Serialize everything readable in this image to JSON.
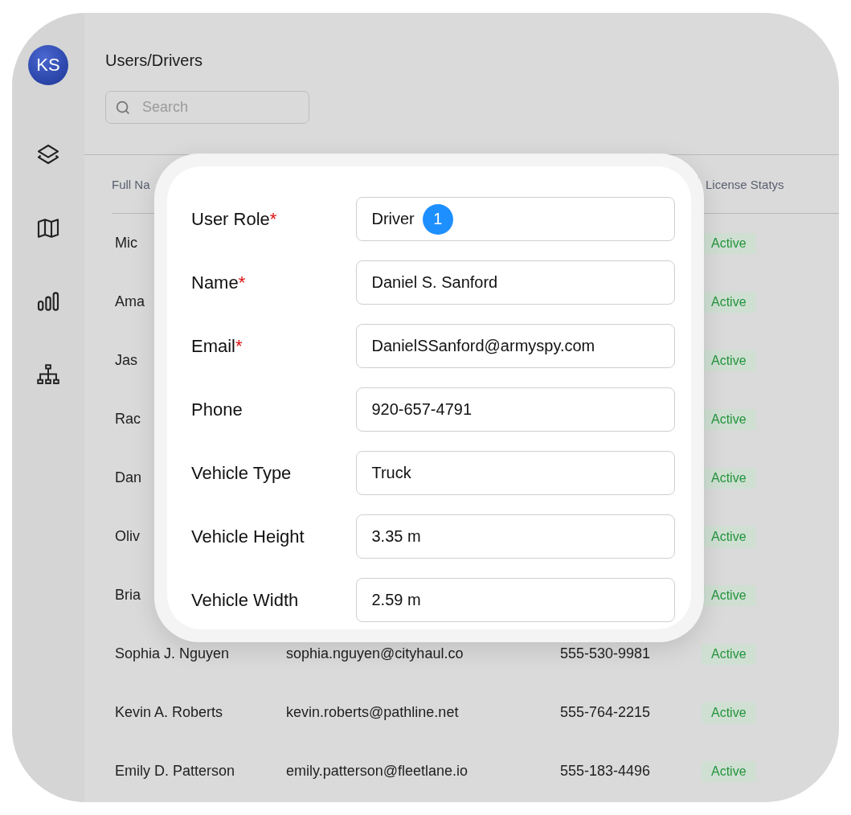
{
  "sidebar": {
    "avatar": "KS",
    "items": [
      {
        "kind": "layers"
      },
      {
        "kind": "map"
      },
      {
        "kind": "bars"
      },
      {
        "kind": "hierarchy"
      }
    ]
  },
  "page_title": "Users/Drivers",
  "search": {
    "placeholder": "Search"
  },
  "table": {
    "columns": [
      {
        "label": "Full Na"
      },
      {
        "label": "License Statys"
      }
    ],
    "rows": [
      {
        "name": "Mic",
        "status": "Active"
      },
      {
        "name": "Ama",
        "status": "Active"
      },
      {
        "name": "Jas",
        "status": "Active"
      },
      {
        "name": "Rac",
        "status": "Active"
      },
      {
        "name": "Dan",
        "status": "Active"
      },
      {
        "name": "Oliv",
        "status": "Active"
      },
      {
        "name": "Bria",
        "status": "Active"
      },
      {
        "name": "Sophia J. Nguyen",
        "email": "sophia.nguyen@cityhaul.co",
        "phone": "555-530-9981",
        "status": "Active"
      },
      {
        "name": "Kevin A. Roberts",
        "email": "kevin.roberts@pathline.net",
        "phone": "555-764-2215",
        "status": "Active"
      },
      {
        "name": "Emily D. Patterson",
        "email": "emily.patterson@fleetlane.io",
        "phone": "555-183-4496",
        "status": "Active"
      }
    ]
  },
  "form": {
    "fields": [
      {
        "label": "User Role",
        "required_mark": "*",
        "value": "Driver",
        "badge": "1"
      },
      {
        "label": "Name",
        "required_mark": "*",
        "value": "Daniel S. Sanford"
      },
      {
        "label": "Email",
        "required_mark": "*",
        "value": "DanielSSanford@armyspy.com"
      },
      {
        "label": "Phone",
        "value": "920-657-4791"
      },
      {
        "label": "Vehicle Type",
        "value": "Truck"
      },
      {
        "label": "Vehicle Height",
        "value": "3.35 m"
      },
      {
        "label": "Vehicle Width",
        "value": "2.59 m"
      }
    ]
  }
}
